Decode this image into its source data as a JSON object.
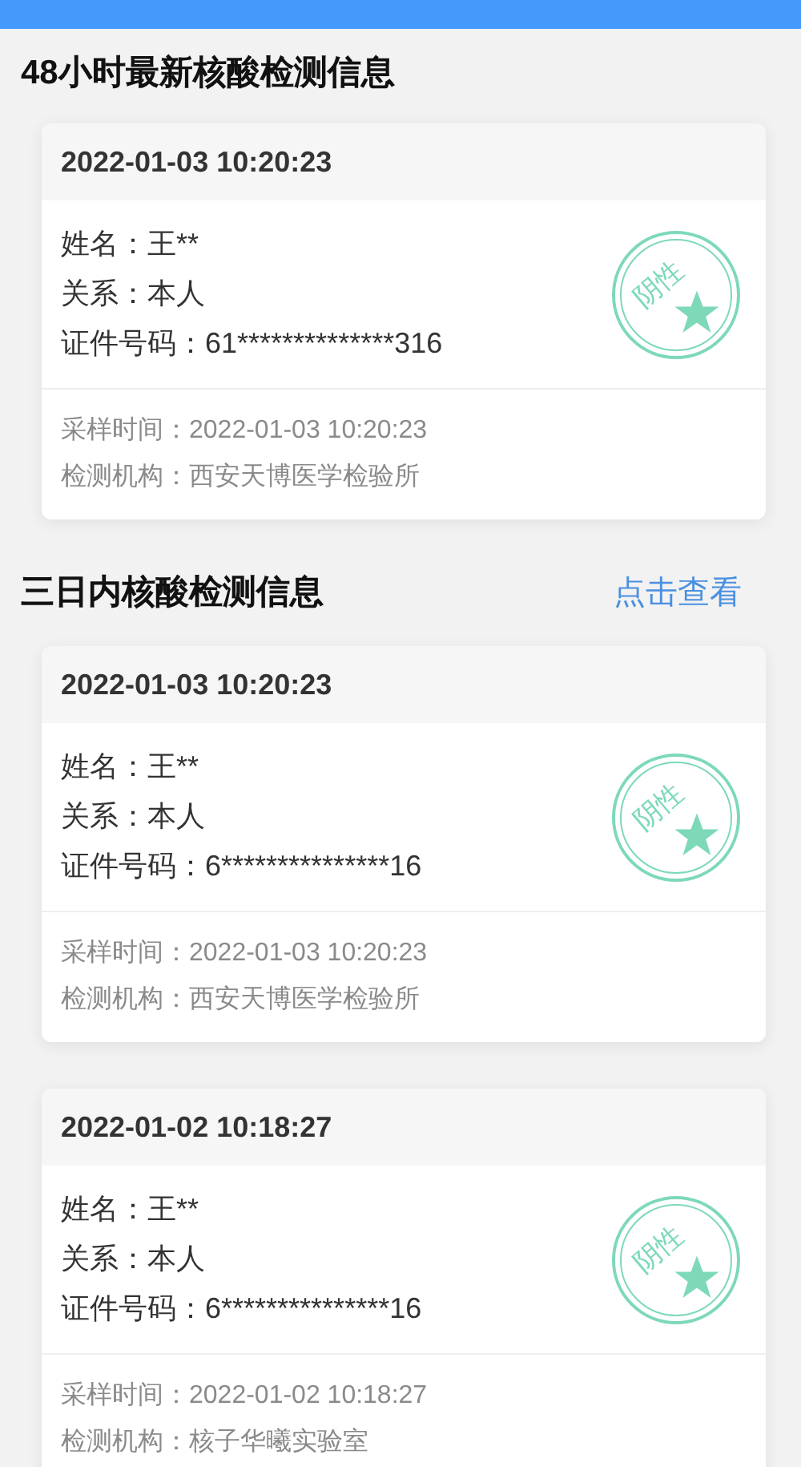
{
  "sections": [
    {
      "title": "48小时最新核酸检测信息",
      "records": [
        {
          "time": "2022-01-03 10:20:23",
          "fields": [
            "姓名：王**",
            "关系：本人",
            "证件号码：61**************316"
          ],
          "stamp": "阴性",
          "details": [
            "采样时间：2022-01-03 10:20:23",
            "检测机构：西安天博医学检验所"
          ]
        }
      ]
    },
    {
      "title": "三日内核酸检测信息",
      "link": "点击查看",
      "records": [
        {
          "time": "2022-01-03 10:20:23",
          "fields": [
            "姓名：王**",
            "关系：本人",
            "证件号码：6***************16"
          ],
          "stamp": "阴性",
          "details": [
            "采样时间：2022-01-03 10:20:23",
            "检测机构：西安天博医学检验所"
          ]
        },
        {
          "time": "2022-01-02 10:18:27",
          "fields": [
            "姓名：王**",
            "关系：本人",
            "证件号码：6***************16"
          ],
          "stamp": "阴性",
          "details": [
            "采样时间：2022-01-02 10:18:27",
            "检测机构：核子华曦实验室"
          ]
        }
      ]
    }
  ]
}
